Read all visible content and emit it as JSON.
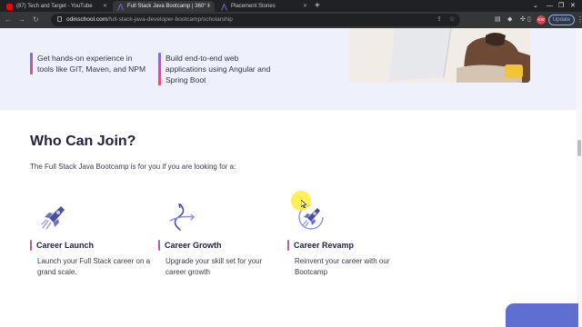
{
  "browser": {
    "tabs": [
      {
        "title": "(87) Tech and Target - YouTube",
        "favicon": "youtube-icon",
        "active": false
      },
      {
        "title": "Full Stack Java Bootcamp | 360° I",
        "favicon": "odinschool-icon",
        "active": true
      },
      {
        "title": "Placement Stories",
        "favicon": "odinschool-icon",
        "active": false
      }
    ],
    "new_tab_label": "+",
    "url_host": "odinschool.com",
    "url_path": "/full-stack-java-developer-bootcamp/scholarship",
    "profile_initials": "KW",
    "update_label": "Update",
    "colors": {
      "tabbar": "#202124",
      "toolbar": "#35363a",
      "accent": "#8ab4f8"
    }
  },
  "hero": {
    "features": [
      "Get hands-on experience in tools like GIT, Maven, and NPM",
      "Build end-to-end web applications using Angular and Spring Boot"
    ]
  },
  "section": {
    "title": "Who Can Join?",
    "subtitle": "The Full Stack Java Bootcamp is for you if you are looking for a:",
    "cards": [
      {
        "title": "Career Launch",
        "description": "Launch your Full Stack career on a grand scale.",
        "icon": "rocket-icon"
      },
      {
        "title": "Career Growth",
        "description": "Upgrade your skill set for your career growth",
        "icon": "growth-arrows-icon"
      },
      {
        "title": "Career Revamp",
        "description": "Reinvent your career with our Bootcamp",
        "icon": "rocket-circle-icon"
      }
    ],
    "colors": {
      "title": "#23213f",
      "bar_start": "#7b6cf2",
      "bar_end": "#ee4f5f",
      "hero_bg": "#eef0fb",
      "widget": "#5f6fd1"
    }
  }
}
